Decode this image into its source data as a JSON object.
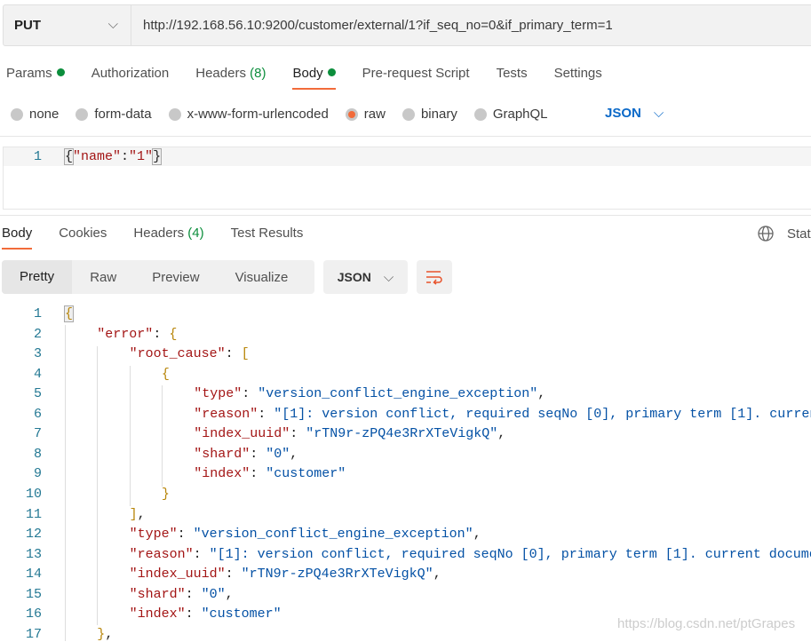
{
  "request": {
    "method": "PUT",
    "url": "http://192.168.56.10:9200/customer/external/1?if_seq_no=0&if_primary_term=1"
  },
  "request_tabs": [
    {
      "label": "Params",
      "dot": true
    },
    {
      "label": "Authorization"
    },
    {
      "label": "Headers",
      "count": "(8)"
    },
    {
      "label": "Body",
      "dot": true,
      "active": true
    },
    {
      "label": "Pre-request Script"
    },
    {
      "label": "Tests"
    },
    {
      "label": "Settings"
    }
  ],
  "body_types": [
    {
      "label": "none"
    },
    {
      "label": "form-data"
    },
    {
      "label": "x-www-form-urlencoded"
    },
    {
      "label": "raw",
      "selected": true
    },
    {
      "label": "binary"
    },
    {
      "label": "GraphQL"
    }
  ],
  "body_format": "JSON",
  "request_body": {
    "line_number": "1",
    "open": "{",
    "key": "\"name\"",
    "colon": ":",
    "value": "\"1\"",
    "close": "}"
  },
  "response_tabs": [
    {
      "label": "Body",
      "active": true
    },
    {
      "label": "Cookies"
    },
    {
      "label": "Headers",
      "count": "(4)"
    },
    {
      "label": "Test Results"
    }
  ],
  "status_label": "Stat",
  "view_modes": [
    "Pretty",
    "Raw",
    "Preview",
    "Visualize"
  ],
  "response_format": "JSON",
  "icons": {
    "method_chevron": "chevron-down-icon",
    "format_chevron": "chevron-down-icon",
    "wrap": "wrap-lines-icon",
    "globe": "globe-icon"
  },
  "colors": {
    "accent": "#f26b3a",
    "green": "#0c8e3c",
    "json_blue": "#0b69c8"
  },
  "response_lines": [
    {
      "n": "1",
      "i": 0,
      "t": [
        [
          "b",
          "{"
        ]
      ]
    },
    {
      "n": "2",
      "i": 1,
      "t": [
        [
          "k",
          "\"error\""
        ],
        [
          "p",
          ": "
        ],
        [
          "b",
          "{"
        ]
      ]
    },
    {
      "n": "3",
      "i": 2,
      "t": [
        [
          "k",
          "\"root_cause\""
        ],
        [
          "p",
          ": "
        ],
        [
          "b",
          "["
        ]
      ]
    },
    {
      "n": "4",
      "i": 3,
      "t": [
        [
          "b",
          "{"
        ]
      ]
    },
    {
      "n": "5",
      "i": 4,
      "t": [
        [
          "k",
          "\"type\""
        ],
        [
          "p",
          ": "
        ],
        [
          "s",
          "\"version_conflict_engine_exception\""
        ],
        [
          "p",
          ","
        ]
      ]
    },
    {
      "n": "6",
      "i": 4,
      "t": [
        [
          "k",
          "\"reason\""
        ],
        [
          "p",
          ": "
        ],
        [
          "s",
          "\"[1]: version conflict, required seqNo [0], primary term [1]. curren"
        ]
      ]
    },
    {
      "n": "7",
      "i": 4,
      "t": [
        [
          "k",
          "\"index_uuid\""
        ],
        [
          "p",
          ": "
        ],
        [
          "s",
          "\"rTN9r-zPQ4e3RrXTeVigkQ\""
        ],
        [
          "p",
          ","
        ]
      ]
    },
    {
      "n": "8",
      "i": 4,
      "t": [
        [
          "k",
          "\"shard\""
        ],
        [
          "p",
          ": "
        ],
        [
          "s",
          "\"0\""
        ],
        [
          "p",
          ","
        ]
      ]
    },
    {
      "n": "9",
      "i": 4,
      "t": [
        [
          "k",
          "\"index\""
        ],
        [
          "p",
          ": "
        ],
        [
          "s",
          "\"customer\""
        ]
      ]
    },
    {
      "n": "10",
      "i": 3,
      "t": [
        [
          "b",
          "}"
        ]
      ]
    },
    {
      "n": "11",
      "i": 2,
      "t": [
        [
          "b",
          "]"
        ],
        [
          "p",
          ","
        ]
      ]
    },
    {
      "n": "12",
      "i": 2,
      "t": [
        [
          "k",
          "\"type\""
        ],
        [
          "p",
          ": "
        ],
        [
          "s",
          "\"version_conflict_engine_exception\""
        ],
        [
          "p",
          ","
        ]
      ]
    },
    {
      "n": "13",
      "i": 2,
      "t": [
        [
          "k",
          "\"reason\""
        ],
        [
          "p",
          ": "
        ],
        [
          "s",
          "\"[1]: version conflict, required seqNo [0], primary term [1]. current docume"
        ]
      ]
    },
    {
      "n": "14",
      "i": 2,
      "t": [
        [
          "k",
          "\"index_uuid\""
        ],
        [
          "p",
          ": "
        ],
        [
          "s",
          "\"rTN9r-zPQ4e3RrXTeVigkQ\""
        ],
        [
          "p",
          ","
        ]
      ]
    },
    {
      "n": "15",
      "i": 2,
      "t": [
        [
          "k",
          "\"shard\""
        ],
        [
          "p",
          ": "
        ],
        [
          "s",
          "\"0\""
        ],
        [
          "p",
          ","
        ]
      ]
    },
    {
      "n": "16",
      "i": 2,
      "t": [
        [
          "k",
          "\"index\""
        ],
        [
          "p",
          ": "
        ],
        [
          "s",
          "\"customer\""
        ]
      ]
    },
    {
      "n": "17",
      "i": 1,
      "t": [
        [
          "b",
          "}"
        ],
        [
          "p",
          ","
        ]
      ]
    }
  ],
  "watermark": "https://blog.csdn.net/ptGrapes"
}
